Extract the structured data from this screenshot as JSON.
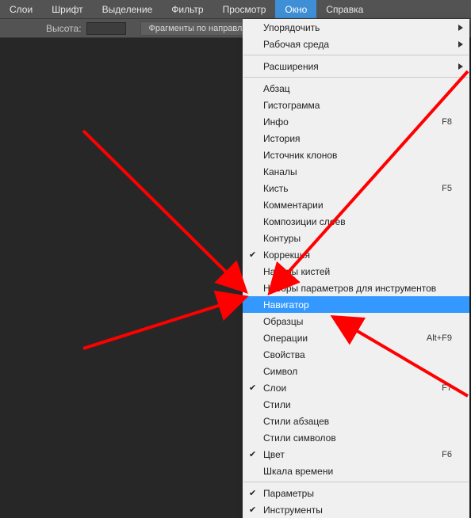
{
  "menubar": {
    "items": [
      "Слои",
      "Шрифт",
      "Выделение",
      "Фильтр",
      "Просмотр",
      "Окно",
      "Справка"
    ],
    "active_index": 5
  },
  "toolbar": {
    "height_label": "Высота:",
    "height_value": "",
    "button_label": "Фрагменты по направляю"
  },
  "dropdown": {
    "sections": [
      [
        {
          "label": "Упорядочить",
          "submenu": true
        },
        {
          "label": "Рабочая среда",
          "submenu": true
        }
      ],
      [
        {
          "label": "Расширения",
          "submenu": true
        }
      ],
      [
        {
          "label": "Абзац"
        },
        {
          "label": "Гистограмма"
        },
        {
          "label": "Инфо",
          "shortcut": "F8"
        },
        {
          "label": "История"
        },
        {
          "label": "Источник клонов"
        },
        {
          "label": "Каналы"
        },
        {
          "label": "Кисть",
          "shortcut": "F5"
        },
        {
          "label": "Комментарии"
        },
        {
          "label": "Композиции слоев"
        },
        {
          "label": "Контуры"
        },
        {
          "label": "Коррекция",
          "checked": true
        },
        {
          "label": "Наборы кистей"
        },
        {
          "label": "Наборы параметров для инструментов"
        },
        {
          "label": "Навигатор",
          "highlight": true
        },
        {
          "label": "Образцы"
        },
        {
          "label": "Операции",
          "shortcut": "Alt+F9"
        },
        {
          "label": "Свойства"
        },
        {
          "label": "Символ"
        },
        {
          "label": "Слои",
          "checked": true,
          "shortcut": "F7"
        },
        {
          "label": "Стили"
        },
        {
          "label": "Стили абзацев"
        },
        {
          "label": "Стили символов"
        },
        {
          "label": "Цвет",
          "checked": true,
          "shortcut": "F6"
        },
        {
          "label": "Шкала времени"
        }
      ],
      [
        {
          "label": "Параметры",
          "checked": true
        },
        {
          "label": "Инструменты",
          "checked": true
        }
      ]
    ]
  }
}
